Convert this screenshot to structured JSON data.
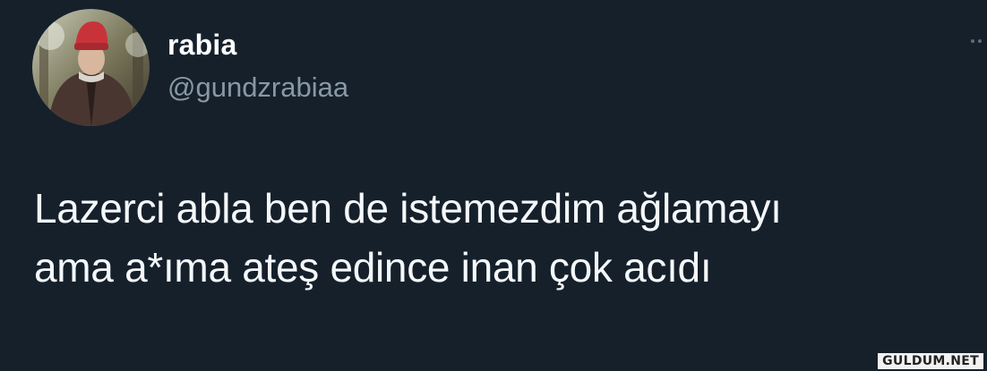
{
  "user": {
    "display_name": "rabia",
    "handle": "@gundzrabiaa"
  },
  "tweet": {
    "lines": [
      "Lazerci abla ben de istemezdim ağlamayı",
      "ama a*ıma ateş edince inan çok acıdı"
    ]
  },
  "icons": {
    "avatar": "profile-photo",
    "more": "more-options-icon"
  },
  "watermark": "GULDUM.NET",
  "colors": {
    "background": "#15202b",
    "handle": "#8899a6",
    "text": "#f5f8fa"
  }
}
